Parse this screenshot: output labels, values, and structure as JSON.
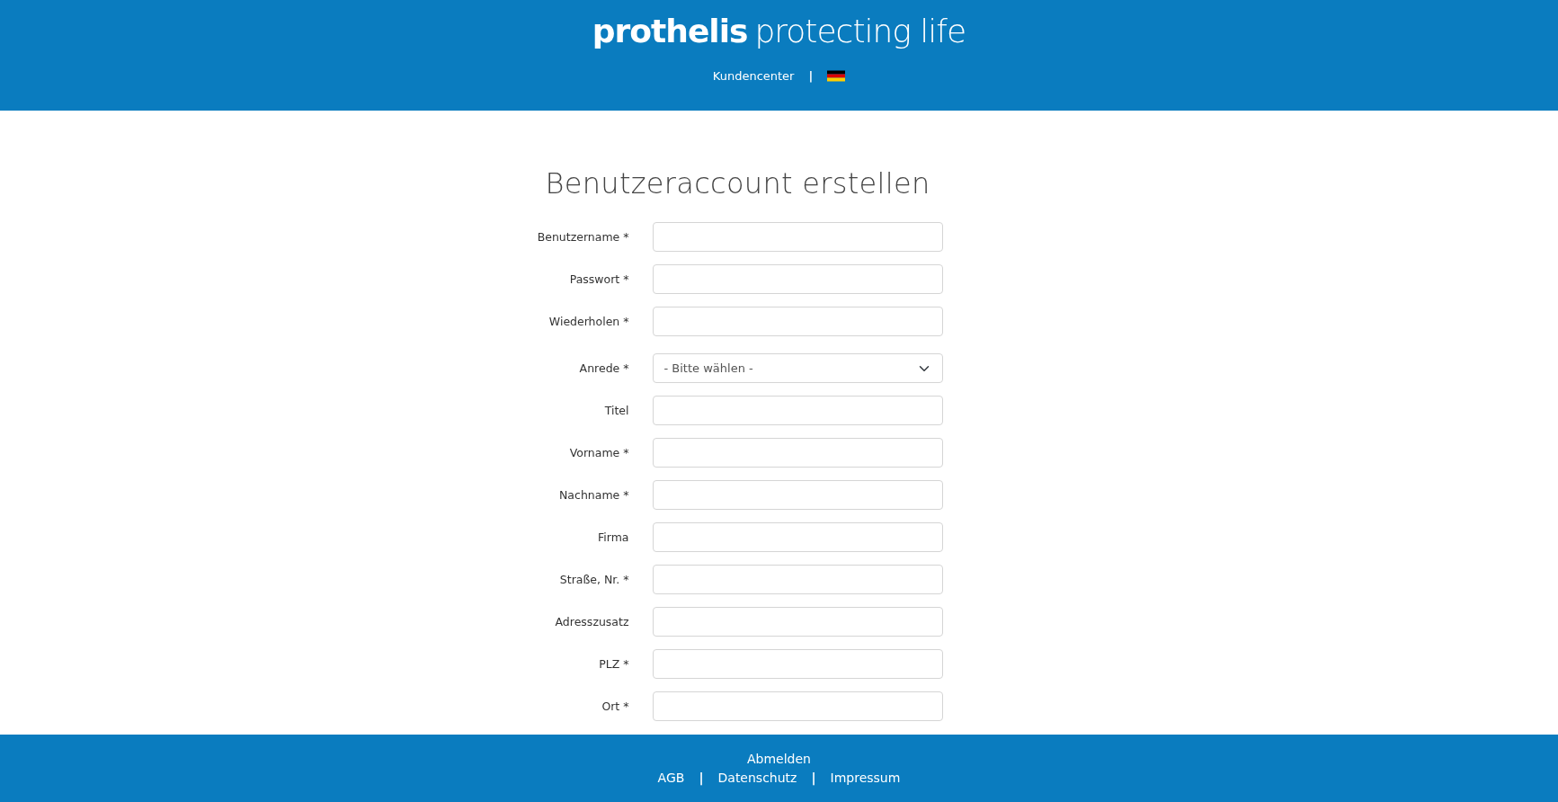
{
  "header": {
    "brand": "prothelis",
    "tagline": "protecting life",
    "nav": [
      {
        "kind": "link",
        "label": "Kundencenter"
      },
      {
        "kind": "separator",
        "label": "|"
      },
      {
        "kind": "flag"
      }
    ]
  },
  "form": {
    "title": "Benutzeraccount erstellen",
    "sections": [
      [
        {
          "label": "Benutzername *",
          "kind": "text"
        },
        {
          "label": "Passwort *",
          "kind": "password"
        },
        {
          "label": "Wiederholen *",
          "kind": "password"
        }
      ],
      [
        {
          "label": "Anrede *",
          "kind": "select",
          "value": "- Bitte wählen -"
        },
        {
          "label": "Titel",
          "kind": "text"
        },
        {
          "label": "Vorname *",
          "kind": "text"
        },
        {
          "label": "Nachname *",
          "kind": "text"
        },
        {
          "label": "Firma",
          "kind": "text"
        },
        {
          "label": "Straße, Nr. *",
          "kind": "text"
        },
        {
          "label": "Adresszusatz",
          "kind": "text"
        },
        {
          "label": "PLZ *",
          "kind": "text"
        },
        {
          "label": "Ort *",
          "kind": "text"
        }
      ]
    ]
  },
  "footer": {
    "top_link": "Abmelden",
    "links": [
      {
        "kind": "link",
        "label": "AGB"
      },
      {
        "kind": "separator",
        "label": "|"
      },
      {
        "kind": "link",
        "label": "Datenschutz"
      },
      {
        "kind": "separator",
        "label": "|"
      },
      {
        "kind": "link",
        "label": "Impressum"
      }
    ]
  }
}
